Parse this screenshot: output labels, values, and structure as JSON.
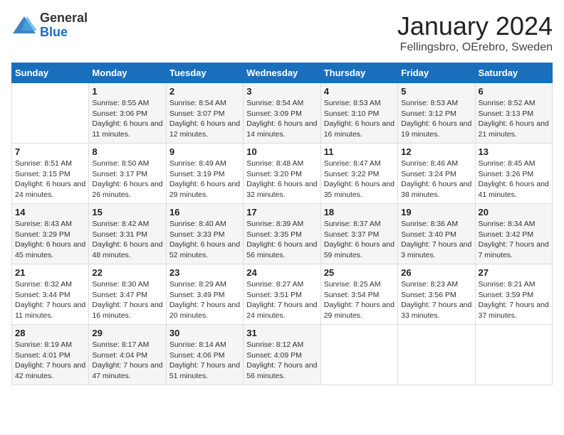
{
  "header": {
    "logo_general": "General",
    "logo_blue": "Blue",
    "month": "January 2024",
    "location": "Fellingsbro, OErebro, Sweden"
  },
  "days_of_week": [
    "Sunday",
    "Monday",
    "Tuesday",
    "Wednesday",
    "Thursday",
    "Friday",
    "Saturday"
  ],
  "weeks": [
    [
      {
        "day": "",
        "sunrise": "",
        "sunset": "",
        "daylight": ""
      },
      {
        "day": "1",
        "sunrise": "Sunrise: 8:55 AM",
        "sunset": "Sunset: 3:06 PM",
        "daylight": "Daylight: 6 hours and 11 minutes."
      },
      {
        "day": "2",
        "sunrise": "Sunrise: 8:54 AM",
        "sunset": "Sunset: 3:07 PM",
        "daylight": "Daylight: 6 hours and 12 minutes."
      },
      {
        "day": "3",
        "sunrise": "Sunrise: 8:54 AM",
        "sunset": "Sunset: 3:09 PM",
        "daylight": "Daylight: 6 hours and 14 minutes."
      },
      {
        "day": "4",
        "sunrise": "Sunrise: 8:53 AM",
        "sunset": "Sunset: 3:10 PM",
        "daylight": "Daylight: 6 hours and 16 minutes."
      },
      {
        "day": "5",
        "sunrise": "Sunrise: 8:53 AM",
        "sunset": "Sunset: 3:12 PM",
        "daylight": "Daylight: 6 hours and 19 minutes."
      },
      {
        "day": "6",
        "sunrise": "Sunrise: 8:52 AM",
        "sunset": "Sunset: 3:13 PM",
        "daylight": "Daylight: 6 hours and 21 minutes."
      }
    ],
    [
      {
        "day": "7",
        "sunrise": "Sunrise: 8:51 AM",
        "sunset": "Sunset: 3:15 PM",
        "daylight": "Daylight: 6 hours and 24 minutes."
      },
      {
        "day": "8",
        "sunrise": "Sunrise: 8:50 AM",
        "sunset": "Sunset: 3:17 PM",
        "daylight": "Daylight: 6 hours and 26 minutes."
      },
      {
        "day": "9",
        "sunrise": "Sunrise: 8:49 AM",
        "sunset": "Sunset: 3:19 PM",
        "daylight": "Daylight: 6 hours and 29 minutes."
      },
      {
        "day": "10",
        "sunrise": "Sunrise: 8:48 AM",
        "sunset": "Sunset: 3:20 PM",
        "daylight": "Daylight: 6 hours and 32 minutes."
      },
      {
        "day": "11",
        "sunrise": "Sunrise: 8:47 AM",
        "sunset": "Sunset: 3:22 PM",
        "daylight": "Daylight: 6 hours and 35 minutes."
      },
      {
        "day": "12",
        "sunrise": "Sunrise: 8:46 AM",
        "sunset": "Sunset: 3:24 PM",
        "daylight": "Daylight: 6 hours and 38 minutes."
      },
      {
        "day": "13",
        "sunrise": "Sunrise: 8:45 AM",
        "sunset": "Sunset: 3:26 PM",
        "daylight": "Daylight: 6 hours and 41 minutes."
      }
    ],
    [
      {
        "day": "14",
        "sunrise": "Sunrise: 8:43 AM",
        "sunset": "Sunset: 3:29 PM",
        "daylight": "Daylight: 6 hours and 45 minutes."
      },
      {
        "day": "15",
        "sunrise": "Sunrise: 8:42 AM",
        "sunset": "Sunset: 3:31 PM",
        "daylight": "Daylight: 6 hours and 48 minutes."
      },
      {
        "day": "16",
        "sunrise": "Sunrise: 8:40 AM",
        "sunset": "Sunset: 3:33 PM",
        "daylight": "Daylight: 6 hours and 52 minutes."
      },
      {
        "day": "17",
        "sunrise": "Sunrise: 8:39 AM",
        "sunset": "Sunset: 3:35 PM",
        "daylight": "Daylight: 6 hours and 56 minutes."
      },
      {
        "day": "18",
        "sunrise": "Sunrise: 8:37 AM",
        "sunset": "Sunset: 3:37 PM",
        "daylight": "Daylight: 6 hours and 59 minutes."
      },
      {
        "day": "19",
        "sunrise": "Sunrise: 8:36 AM",
        "sunset": "Sunset: 3:40 PM",
        "daylight": "Daylight: 7 hours and 3 minutes."
      },
      {
        "day": "20",
        "sunrise": "Sunrise: 8:34 AM",
        "sunset": "Sunset: 3:42 PM",
        "daylight": "Daylight: 7 hours and 7 minutes."
      }
    ],
    [
      {
        "day": "21",
        "sunrise": "Sunrise: 8:32 AM",
        "sunset": "Sunset: 3:44 PM",
        "daylight": "Daylight: 7 hours and 11 minutes."
      },
      {
        "day": "22",
        "sunrise": "Sunrise: 8:30 AM",
        "sunset": "Sunset: 3:47 PM",
        "daylight": "Daylight: 7 hours and 16 minutes."
      },
      {
        "day": "23",
        "sunrise": "Sunrise: 8:29 AM",
        "sunset": "Sunset: 3:49 PM",
        "daylight": "Daylight: 7 hours and 20 minutes."
      },
      {
        "day": "24",
        "sunrise": "Sunrise: 8:27 AM",
        "sunset": "Sunset: 3:51 PM",
        "daylight": "Daylight: 7 hours and 24 minutes."
      },
      {
        "day": "25",
        "sunrise": "Sunrise: 8:25 AM",
        "sunset": "Sunset: 3:54 PM",
        "daylight": "Daylight: 7 hours and 29 minutes."
      },
      {
        "day": "26",
        "sunrise": "Sunrise: 8:23 AM",
        "sunset": "Sunset: 3:56 PM",
        "daylight": "Daylight: 7 hours and 33 minutes."
      },
      {
        "day": "27",
        "sunrise": "Sunrise: 8:21 AM",
        "sunset": "Sunset: 3:59 PM",
        "daylight": "Daylight: 7 hours and 37 minutes."
      }
    ],
    [
      {
        "day": "28",
        "sunrise": "Sunrise: 8:19 AM",
        "sunset": "Sunset: 4:01 PM",
        "daylight": "Daylight: 7 hours and 42 minutes."
      },
      {
        "day": "29",
        "sunrise": "Sunrise: 8:17 AM",
        "sunset": "Sunset: 4:04 PM",
        "daylight": "Daylight: 7 hours and 47 minutes."
      },
      {
        "day": "30",
        "sunrise": "Sunrise: 8:14 AM",
        "sunset": "Sunset: 4:06 PM",
        "daylight": "Daylight: 7 hours and 51 minutes."
      },
      {
        "day": "31",
        "sunrise": "Sunrise: 8:12 AM",
        "sunset": "Sunset: 4:09 PM",
        "daylight": "Daylight: 7 hours and 56 minutes."
      },
      {
        "day": "",
        "sunrise": "",
        "sunset": "",
        "daylight": ""
      },
      {
        "day": "",
        "sunrise": "",
        "sunset": "",
        "daylight": ""
      },
      {
        "day": "",
        "sunrise": "",
        "sunset": "",
        "daylight": ""
      }
    ]
  ]
}
